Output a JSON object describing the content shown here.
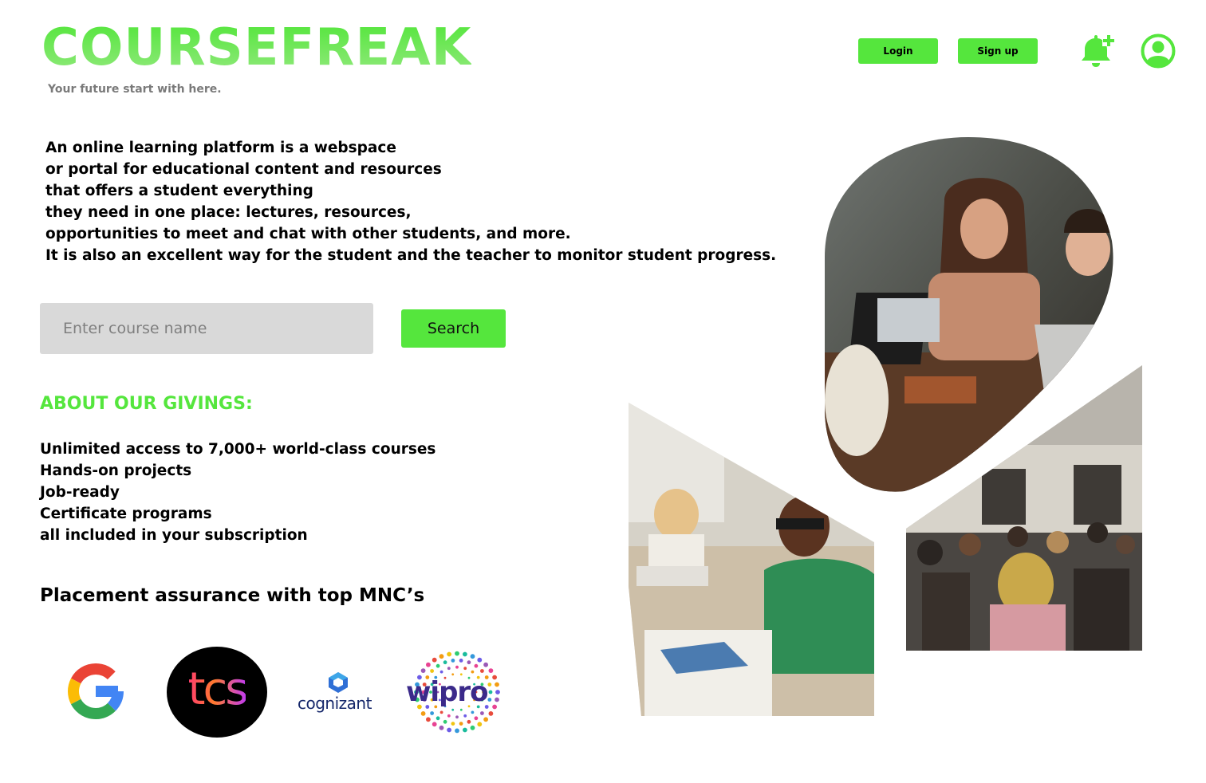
{
  "brand": {
    "title": "COURSEFREAK",
    "tagline": "Your future start with here."
  },
  "header": {
    "login_label": "Login",
    "signup_label": "Sign up",
    "icons": [
      "bell-plus-icon",
      "user-avatar-icon"
    ]
  },
  "intro": {
    "lines": [
      "An online learning platform is a webspace",
      "or portal for educational content and resources",
      "that offers a student everything",
      "they need in one place: lectures, resources,",
      "opportunities to meet and chat with other students, and more.",
      "It is also an excellent way for the student and the teacher to monitor student progress."
    ]
  },
  "search": {
    "placeholder": "Enter course name",
    "value": "",
    "button_label": "Search"
  },
  "about": {
    "heading": "ABOUT OUR GIVINGS:",
    "items": [
      "Unlimited access to 7,000+ world-class courses",
      "Hands-on projects",
      "Job-ready",
      "Certificate programs",
      "all included in your subscription"
    ]
  },
  "placement": {
    "heading": "Placement assurance with top MNC’s",
    "logos": [
      {
        "name": "google-logo",
        "text": "G"
      },
      {
        "name": "tcs-logo",
        "text": "tcs"
      },
      {
        "name": "cognizant-logo",
        "text": "cognizant"
      },
      {
        "name": "wipro-logo",
        "text": "wipro"
      }
    ]
  },
  "colors": {
    "accent": "#55e63d",
    "input_bg": "#d9d9d9",
    "tagline": "#7a7a7a",
    "text": "#000000"
  }
}
